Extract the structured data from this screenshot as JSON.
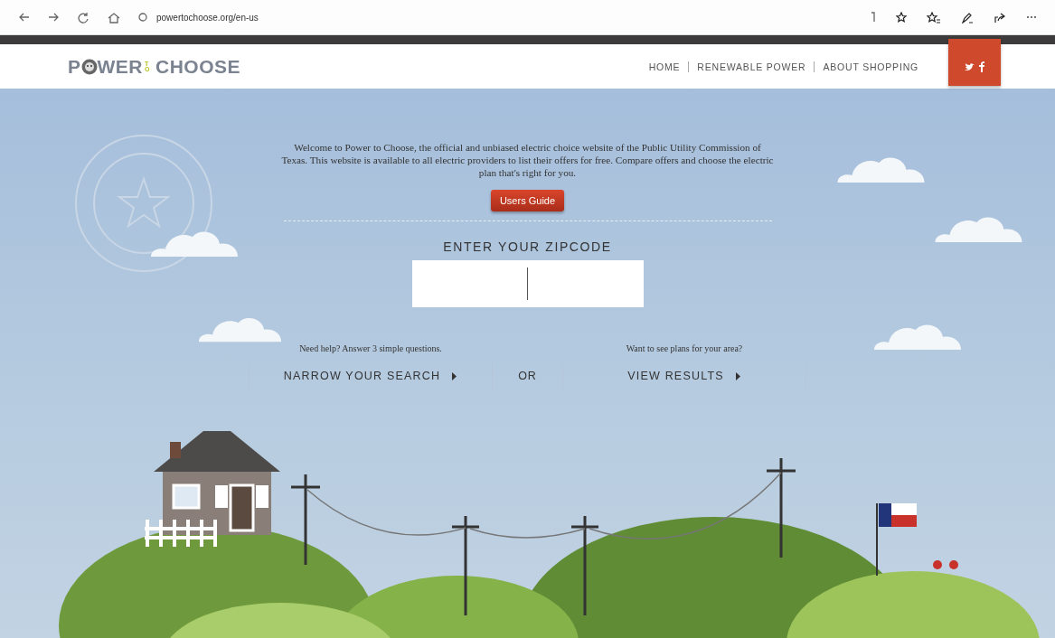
{
  "browser": {
    "url": "powertochoose.org/en-us"
  },
  "header": {
    "logo": [
      "P",
      "WER",
      "TO",
      "CHOOSE"
    ],
    "nav": [
      {
        "label": "HOME"
      },
      {
        "label": "RENEWABLE POWER"
      },
      {
        "label": "ABOUT SHOPPING"
      }
    ]
  },
  "hero": {
    "intro": "Welcome to Power to Choose, the official and unbiased electric choice website of the Public Utility Commission of Texas. This website is available to all electric providers to list their offers for free. Compare offers and choose the electric plan that's right for you.",
    "guide_button": "Users Guide",
    "zip_label": "ENTER YOUR ZIPCODE",
    "left": {
      "prompt": "Need help? Answer 3 simple questions.",
      "button": "NARROW YOUR SEARCH"
    },
    "or": "OR",
    "right": {
      "prompt": "Want to see plans for your area?",
      "button": "VIEW RESULTS"
    }
  }
}
